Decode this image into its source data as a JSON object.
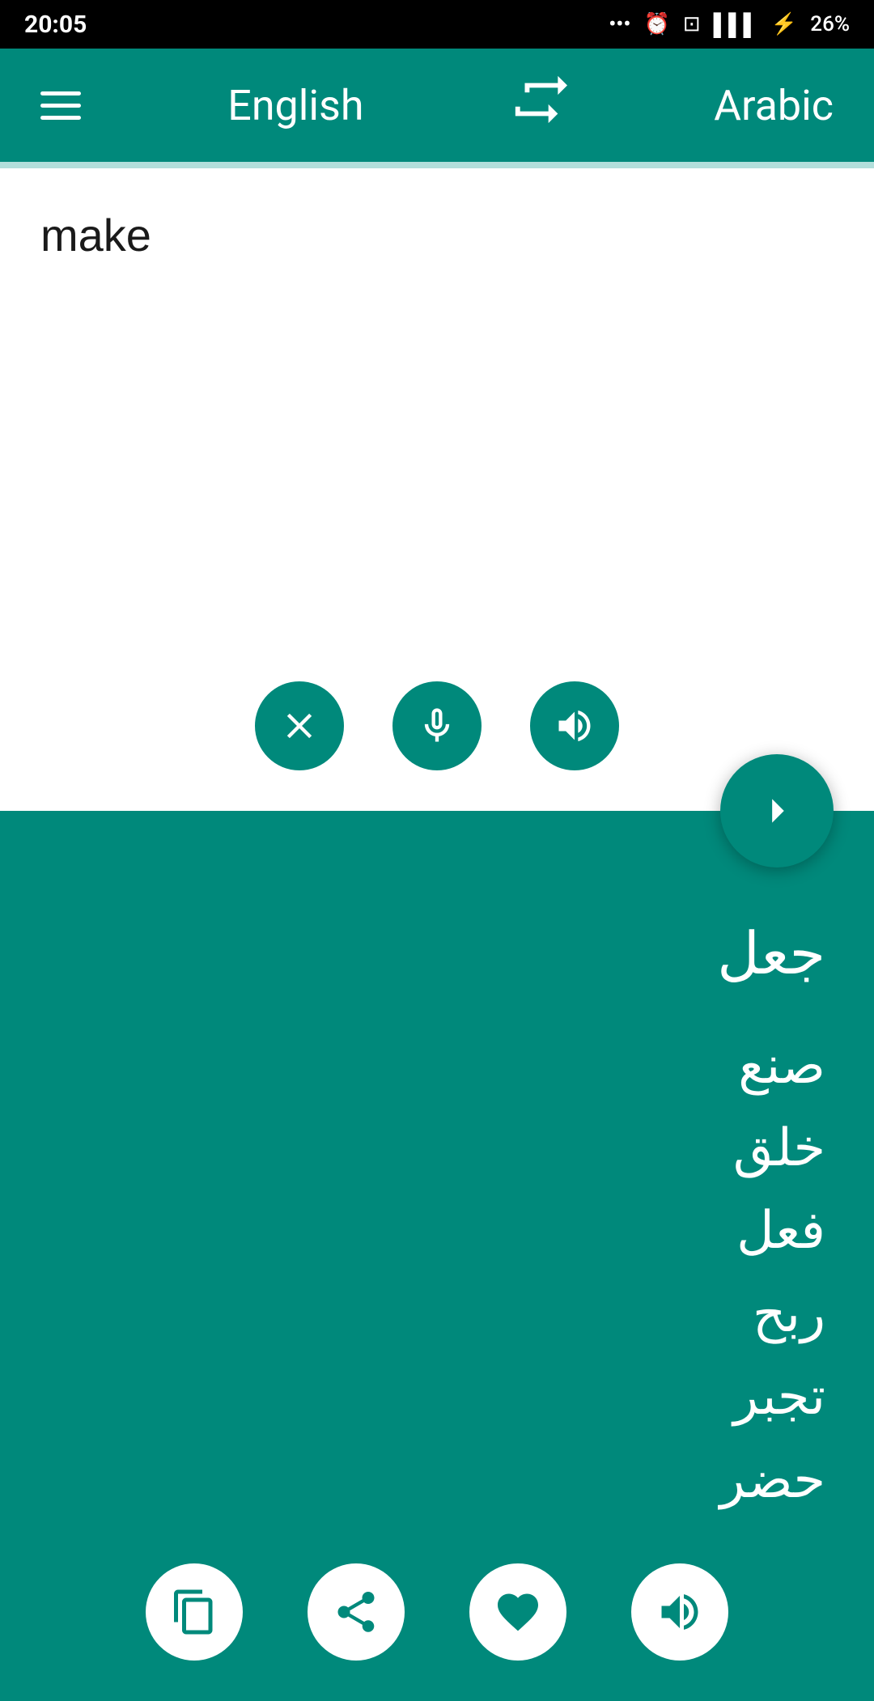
{
  "statusBar": {
    "time": "20:05",
    "battery": "26%"
  },
  "header": {
    "menuIcon": "menu",
    "sourceLang": "English",
    "swapIcon": "swap",
    "targetLang": "Arabic"
  },
  "inputArea": {
    "value": "make",
    "placeholder": ""
  },
  "controls": {
    "clearLabel": "clear",
    "micLabel": "microphone",
    "speakerLabel": "speaker",
    "translateLabel": "translate"
  },
  "output": {
    "mainTranslation": "جعل",
    "alternatives": "صنع\nخلق\nفعل\nربح\nتجبر\nحضر"
  },
  "bottomControls": {
    "copyLabel": "copy",
    "shareLabel": "share",
    "favoriteLabel": "favorite",
    "speakerLabel": "speaker"
  }
}
